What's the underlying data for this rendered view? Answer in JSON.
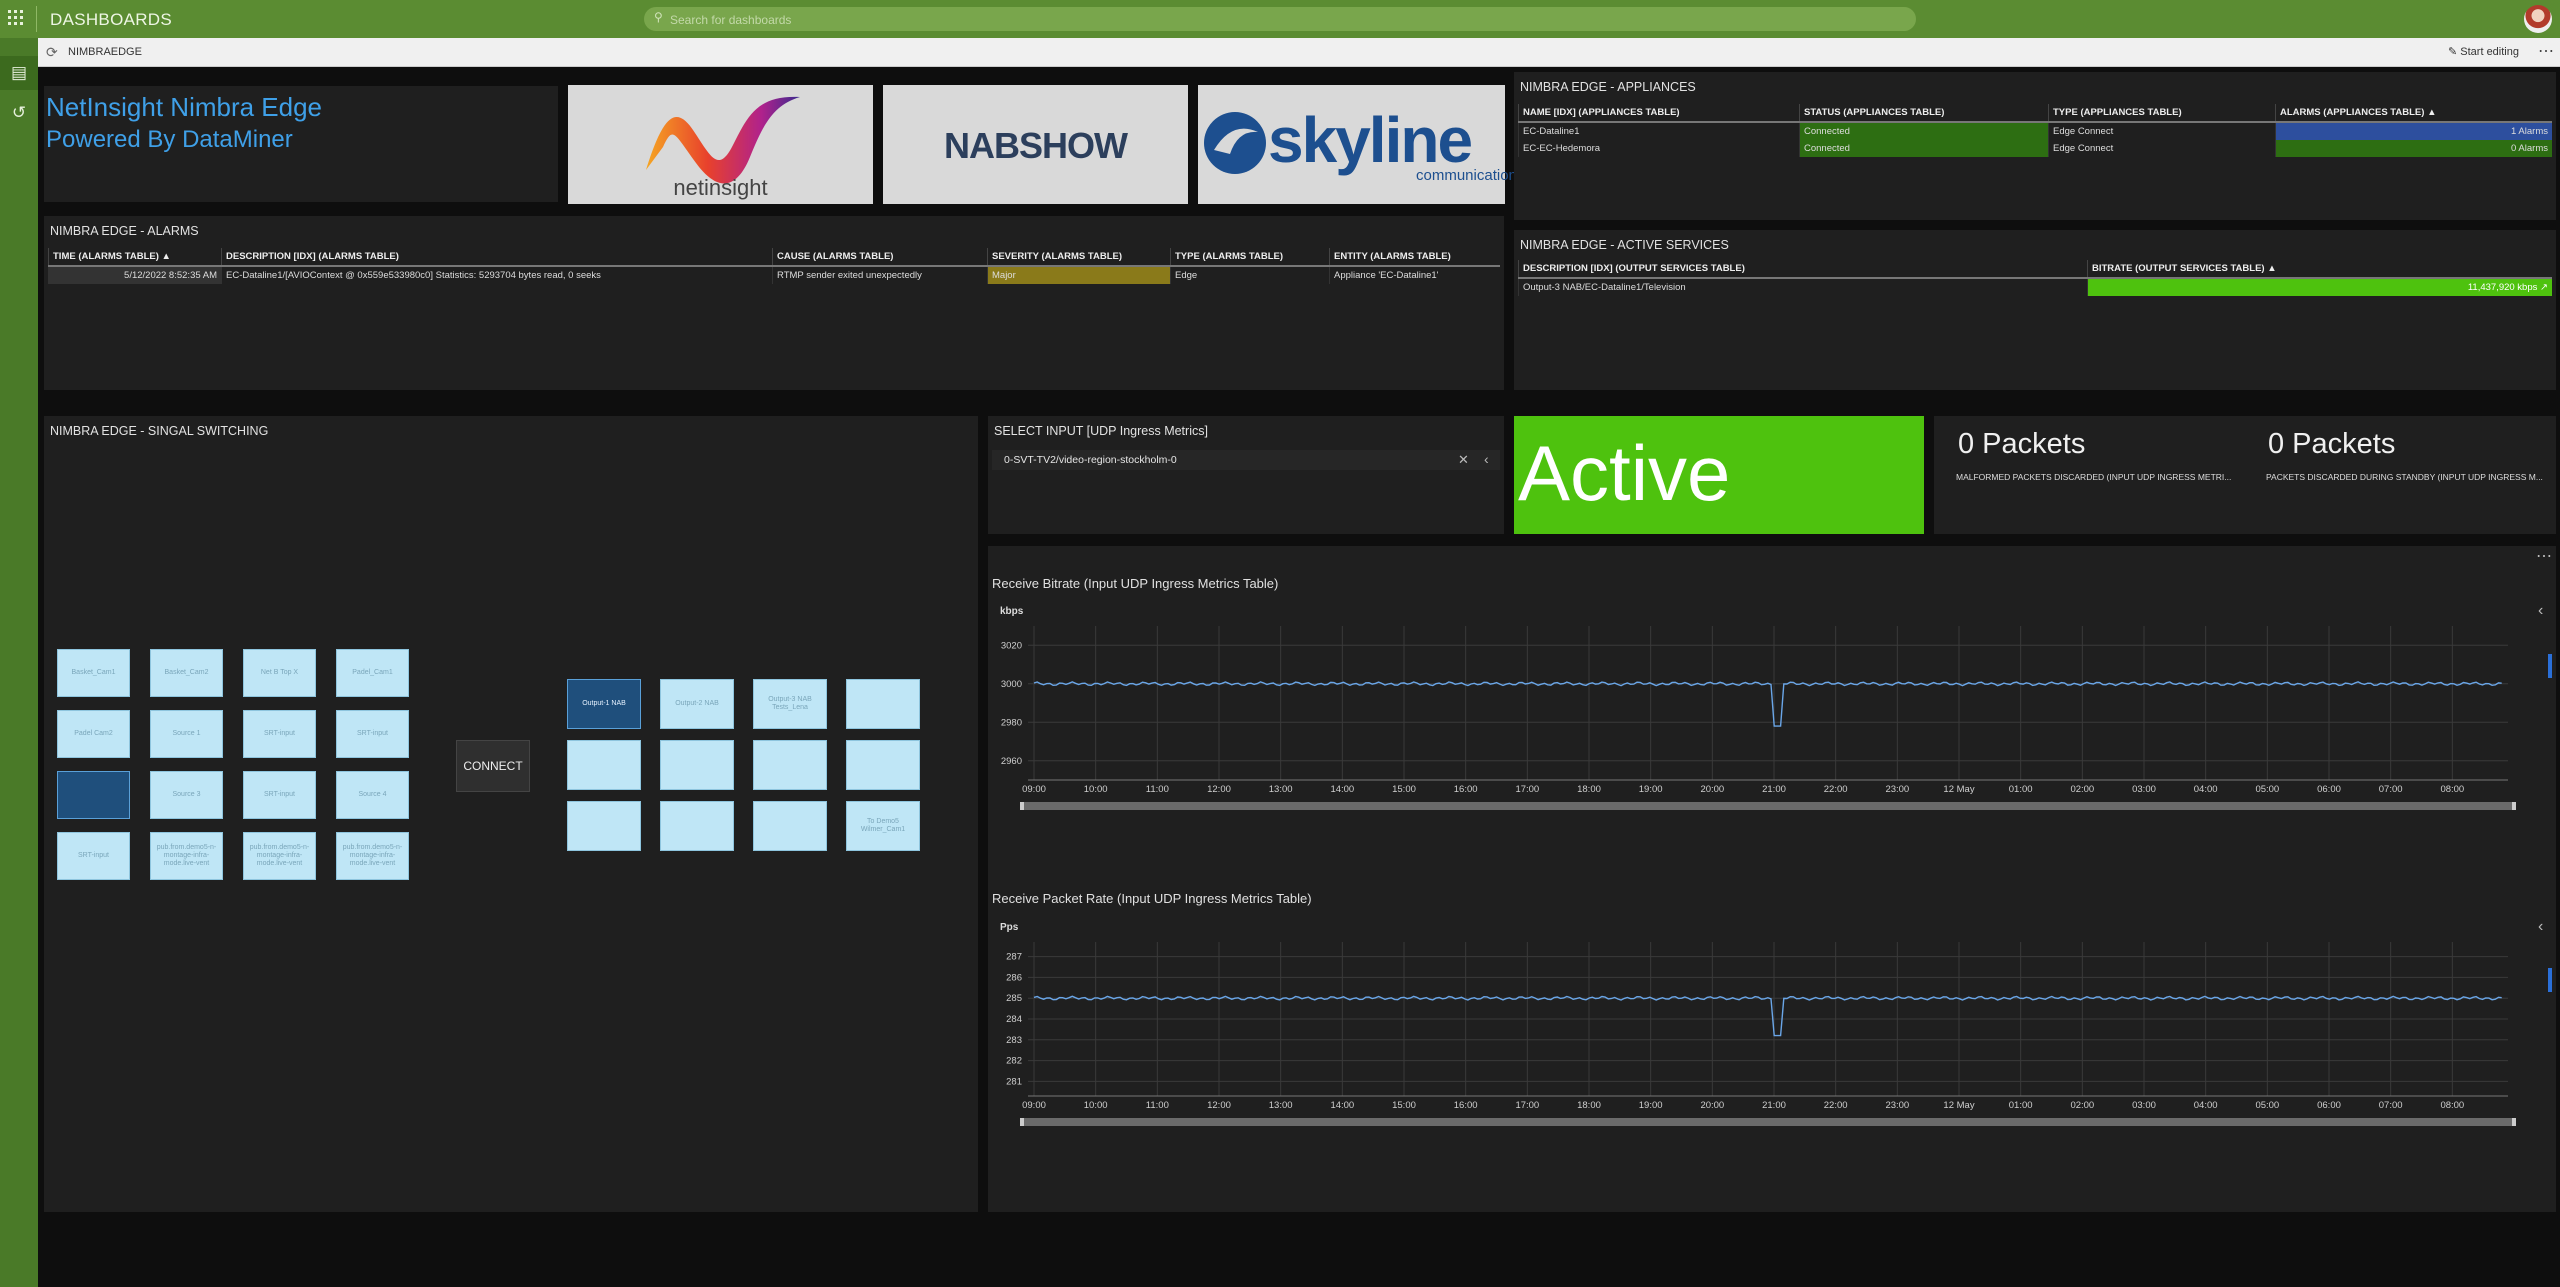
{
  "app": {
    "title": "DASHBOARDS"
  },
  "search": {
    "placeholder": "Search for dashboards"
  },
  "breadcrumb": {
    "current": "NIMBRAEDGE"
  },
  "toolbar": {
    "start_editing": "Start editing"
  },
  "header": {
    "title": "NetInsight Nimbra Edge",
    "subtitle": "Powered By DataMiner"
  },
  "logos": {
    "netinsight": "netinsight",
    "nabshow": "NABSHOW",
    "skyline": "skyline",
    "skyline_sub": "communications"
  },
  "alarms": {
    "title": "NIMBRA EDGE - ALARMS",
    "columns": [
      "TIME (ALARMS TABLE)",
      "DESCRIPTION [IDX] (ALARMS TABLE)",
      "CAUSE (ALARMS TABLE)",
      "SEVERITY (ALARMS TABLE)",
      "TYPE (ALARMS TABLE)",
      "ENTITY (ALARMS TABLE)"
    ],
    "rows": [
      [
        "5/12/2022 8:52:35 AM",
        "EC-Dataline1/[AVIOContext @ 0x559e533980c0] Statistics: 5293704 bytes read, 0 seeks",
        "RTMP sender exited unexpectedly",
        "Major",
        "Edge",
        "Appliance 'EC-Dataline1'"
      ]
    ],
    "severity_color": "#8a7a1a"
  },
  "appliances": {
    "title": "NIMBRA EDGE - APPLIANCES",
    "columns": [
      "NAME [IDX] (APPLIANCES TABLE)",
      "STATUS (APPLIANCES TABLE)",
      "TYPE (APPLIANCES TABLE)",
      "ALARMS (APPLIANCES TABLE)"
    ],
    "rows": [
      [
        "EC-Dataline1",
        "Connected",
        "Edge Connect",
        "1 Alarms"
      ],
      [
        "EC-EC-Hedemora",
        "Connected",
        "Edge Connect",
        "0 Alarms"
      ]
    ],
    "status_color": "#2d6e12",
    "alarm_colors": [
      "#2d4f9e",
      "#2d6e12"
    ]
  },
  "services": {
    "title": "NIMBRA EDGE - ACTIVE SERVICES",
    "columns": [
      "DESCRIPTION [IDX] (OUTPUT SERVICES TABLE)",
      "BITRATE (OUTPUT SERVICES TABLE)"
    ],
    "rows": [
      [
        "Output-3 NAB/EC-Dataline1/Television",
        "11,437,920 kbps"
      ]
    ],
    "bitrate_color": "#4ec20e"
  },
  "switching": {
    "title": "NIMBRA EDGE - SINGAL SWITCHING",
    "connect_label": "CONNECT",
    "inputs": [
      [
        "Basket_Cam1",
        "Basket_Cam2",
        "Net B Top X",
        "Padel_Cam1"
      ],
      [
        "Padel Cam2",
        "Source 1",
        "SRT-input",
        "SRT-input"
      ],
      [
        "",
        "Source 3",
        "SRT-input",
        "Source 4"
      ],
      [
        "SRT-input",
        "pub.from.demo5-n-montage-infra-mode.live-vent",
        "pub.from.demo5-n-montage-infra-mode.live-vent",
        "pub.from.demo5-n-montage-infra-mode.live-vent"
      ]
    ],
    "outputs": [
      [
        "Output-1 NAB",
        "Output-2 NAB",
        "Output-3 NAB Tests_Lena",
        ""
      ],
      [
        "",
        "",
        "",
        ""
      ],
      [
        "",
        "",
        "",
        "To Demo5 Wilmer_Cam1"
      ]
    ]
  },
  "select_input": {
    "title": "SELECT INPUT [UDP Ingress Metrics]",
    "value": "0-SVT-TV2/video-region-stockholm-0"
  },
  "status": {
    "label": "Active",
    "color": "#4ec20e"
  },
  "malformed": {
    "value": "0 Packets",
    "label": "MALFORMED PACKETS DISCARDED (INPUT UDP INGRESS METRI..."
  },
  "standby": {
    "value": "0 Packets",
    "label": "PACKETS DISCARDED DURING STANDBY (INPUT UDP INGRESS M..."
  },
  "chart_data": [
    {
      "type": "line",
      "title": "Receive Bitrate (Input UDP Ingress Metrics Table)",
      "ylabel": "kbps",
      "ylim": [
        2950,
        3030
      ],
      "yticks": [
        3020,
        3000,
        2980,
        2960
      ],
      "xticks": [
        "09:00",
        "10:00",
        "11:00",
        "12:00",
        "13:00",
        "14:00",
        "15:00",
        "16:00",
        "17:00",
        "18:00",
        "19:00",
        "20:00",
        "21:00",
        "22:00",
        "23:00",
        "12 May",
        "01:00",
        "02:00",
        "03:00",
        "04:00",
        "05:00",
        "06:00",
        "07:00",
        "08:00"
      ],
      "grid": true,
      "series": [
        {
          "values": [
            3000,
            3000,
            3000,
            3000,
            3000,
            3000,
            3000,
            3000,
            3000,
            3000,
            3000,
            3000,
            3000,
            3000,
            3000,
            3000,
            3000,
            3000,
            3000,
            3000,
            3000,
            3000,
            3000,
            3000
          ],
          "dip": {
            "at": 12.05,
            "value": 2978
          }
        }
      ],
      "color": "#6aa6e8"
    },
    {
      "type": "line",
      "title": "Receive Packet Rate (Input UDP Ingress Metrics Table)",
      "ylabel": "Pps",
      "ylim": [
        280.3,
        287.7
      ],
      "yticks": [
        287,
        286,
        285,
        284,
        283,
        282,
        281
      ],
      "xticks": [
        "09:00",
        "10:00",
        "11:00",
        "12:00",
        "13:00",
        "14:00",
        "15:00",
        "16:00",
        "17:00",
        "18:00",
        "19:00",
        "20:00",
        "21:00",
        "22:00",
        "23:00",
        "12 May",
        "01:00",
        "02:00",
        "03:00",
        "04:00",
        "05:00",
        "06:00",
        "07:00",
        "08:00"
      ],
      "grid": true,
      "series": [
        {
          "values": [
            285,
            285,
            285,
            285,
            285,
            285,
            285,
            285,
            285,
            285,
            285,
            285,
            285,
            285,
            285,
            285,
            285,
            285,
            285,
            285,
            285,
            285,
            285,
            285
          ],
          "dip": {
            "at": 12.05,
            "value": 283.2
          }
        }
      ],
      "color": "#6aa6e8"
    }
  ]
}
